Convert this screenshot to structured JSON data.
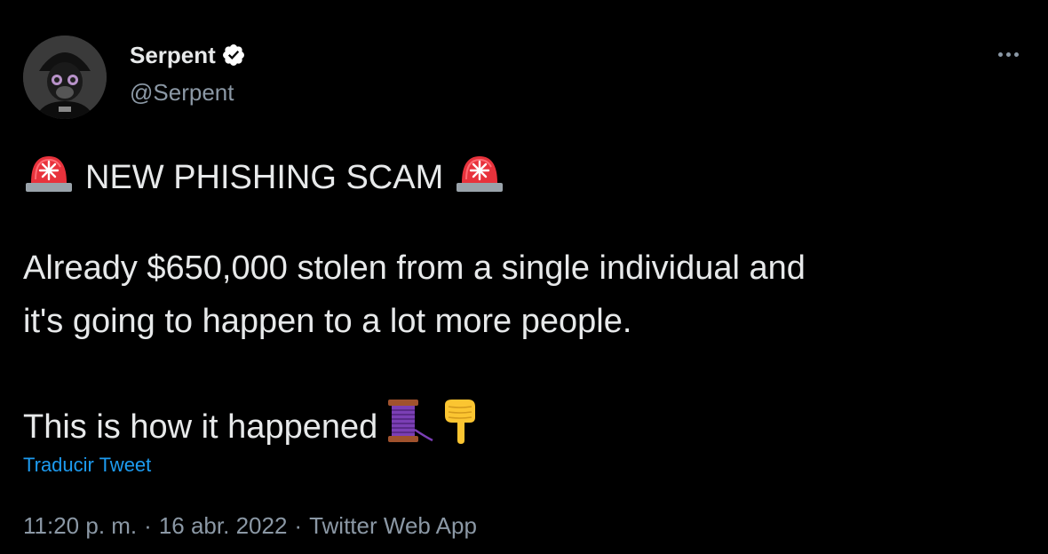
{
  "author": {
    "display_name": "Serpent",
    "handle": "@Serpent",
    "verified": true,
    "avatar": "avatar-image"
  },
  "header": {
    "more_icon": "more-horizontal-icon"
  },
  "tweet": {
    "line1": {
      "emoji_left": "police-light-emoji",
      "text": "NEW PHISHING SCAM",
      "emoji_right": "police-light-emoji"
    },
    "line2": "Already $650,000 stolen from a single individual and",
    "line3": "it's going to happen to a lot more people.",
    "line4": {
      "text": "This is how it happened",
      "emoji_1": "thread-spool-emoji",
      "emoji_2": "pointing-down-emoji"
    }
  },
  "translate_label": "Traducir Tweet",
  "meta": {
    "time": "11:20 p. m.",
    "separator": "·",
    "date": "16 abr. 2022",
    "source": "Twitter Web App"
  },
  "colors": {
    "background": "#000000",
    "text": "#e7e9ea",
    "muted": "#8b98a5",
    "link": "#1d9bf0",
    "verified": "#ffffff"
  }
}
